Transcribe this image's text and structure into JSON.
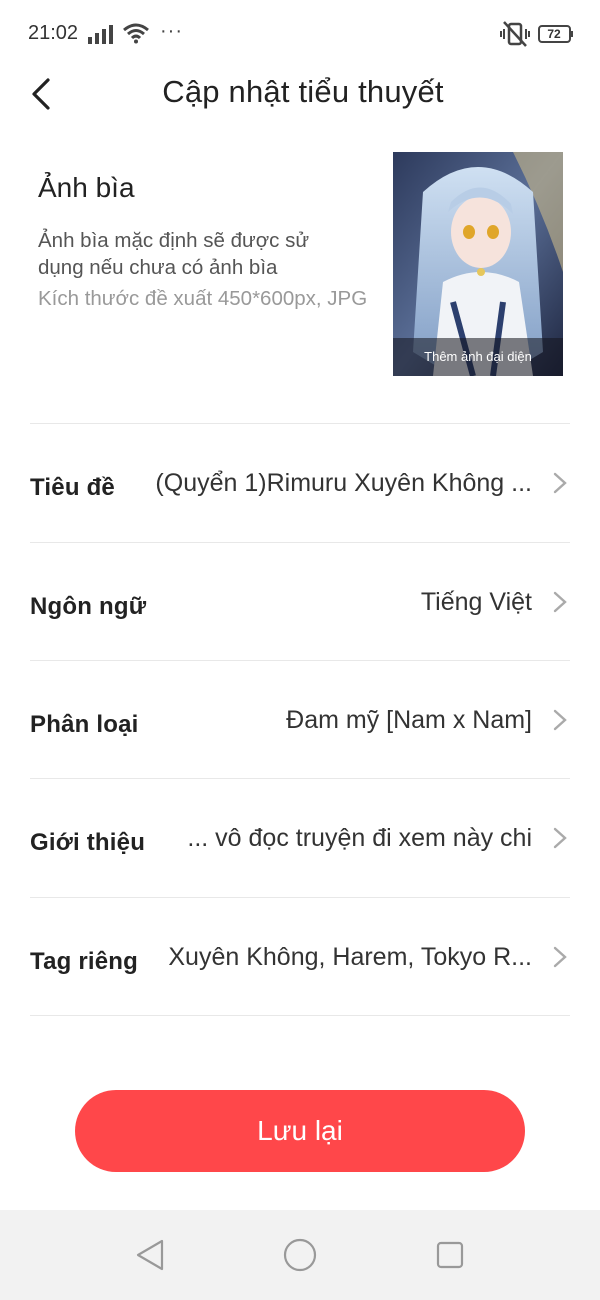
{
  "status_bar": {
    "time": "21:02",
    "more_indicator": "···",
    "battery_level": "72",
    "icons": [
      "signal-icon",
      "wifi-icon",
      "vibrate-icon",
      "battery-icon"
    ]
  },
  "header": {
    "back_icon": "chevron-left-icon",
    "title": "Cập nhật tiểu thuyết"
  },
  "cover": {
    "title": "Ảnh bìa",
    "description": "Ảnh bìa mặc định sẽ được sử dụng nếu chưa có ảnh bìa",
    "size_hint": "Kích thước đề xuất 450*600px, JPG",
    "image_caption": "Thêm ảnh đại diện"
  },
  "form": {
    "rows": [
      {
        "label": "Tiêu đề",
        "value": "(Quyển 1)Rimuru Xuyên Không ..."
      },
      {
        "label": "Ngôn ngữ",
        "value": "Tiếng Việt"
      },
      {
        "label": "Phân loại",
        "value": "Đam mỹ [Nam x Nam]"
      },
      {
        "label": "Giới thiệu",
        "value": "... vô đọc truyện đi xem này chi"
      },
      {
        "label": "Tag riêng",
        "value": "Xuyên Không, Harem, Tokyo R..."
      }
    ]
  },
  "actions": {
    "save_label": "Lưu lại",
    "save_color": "#ff474a"
  },
  "nav_bar": {
    "icons": [
      "nav-back-icon",
      "nav-home-icon",
      "nav-recents-icon"
    ]
  }
}
